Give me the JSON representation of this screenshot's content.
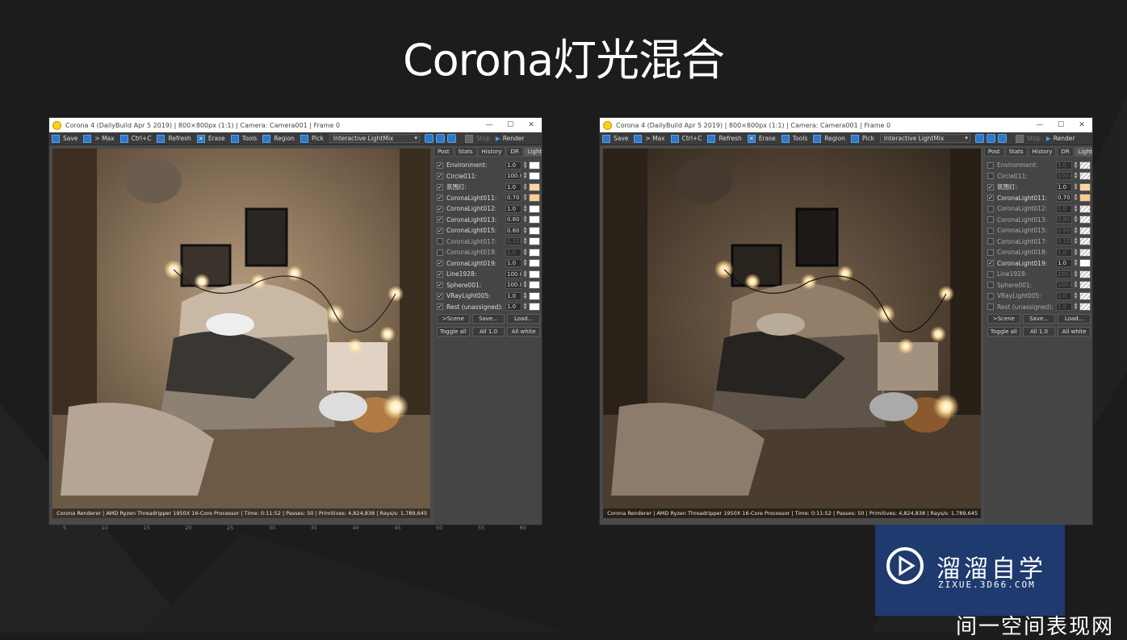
{
  "slide": {
    "title": "Corona灯光混合",
    "footer_text": "间一空间表现网"
  },
  "windows": [
    {
      "id": "left",
      "titlebar": "Corona 4 (DailyBuild Apr  5 2019) | 800×800px (1:1) | Camera: Camera001 | Frame 0",
      "toolbar": {
        "save": "Save",
        "max": "> Max",
        "copy": "Ctrl+C",
        "refresh": "Refresh",
        "erase": "Erase",
        "tools": "Tools",
        "region": "Region",
        "pick": "Pick",
        "dropdown": "Interactive LightMix",
        "stop": "Stop",
        "render": "Render"
      },
      "tabs": [
        "Post",
        "Stats",
        "History",
        "DR",
        "LightMix"
      ],
      "lights": [
        {
          "name": "Environment:",
          "value": "1.0",
          "checked": true,
          "swatch": "#ffffff"
        },
        {
          "name": "Circle011:",
          "value": "100.0",
          "checked": true,
          "swatch": "#ffffff"
        },
        {
          "name": "氛围灯:",
          "value": "1.0",
          "checked": true,
          "swatch": "#fdd5a3"
        },
        {
          "name": "CoronaLight011:",
          "value": "0.70",
          "checked": true,
          "swatch": "#fdcc8f"
        },
        {
          "name": "CoronaLight012:",
          "value": "1.0",
          "checked": true,
          "swatch": "#ffffff"
        },
        {
          "name": "CoronaLight013:",
          "value": "0.80",
          "checked": true,
          "swatch": "#ffffff"
        },
        {
          "name": "CoronaLight015:",
          "value": "0.80",
          "checked": true,
          "swatch": "#ffffff"
        },
        {
          "name": "CoronaLight017:",
          "value": "0.328",
          "checked": false,
          "swatch": "#ffffff"
        },
        {
          "name": "CoronaLight018:",
          "value": "1.0",
          "checked": false,
          "swatch": "#ffffff"
        },
        {
          "name": "CoronaLight019:",
          "value": "1.0",
          "checked": true,
          "swatch": "#ffffff"
        },
        {
          "name": "Line1928:",
          "value": "100.0",
          "checked": true,
          "swatch": "#ffffff"
        },
        {
          "name": "Sphere001:",
          "value": "100.0",
          "checked": true,
          "swatch": "#ffffff"
        },
        {
          "name": "VRayLight005:",
          "value": "1.0",
          "checked": true,
          "swatch": "#ffffff"
        },
        {
          "name": "Rest (unassigned):",
          "value": "1.0",
          "checked": true,
          "swatch": "#ffffff"
        }
      ],
      "buttons1": [
        ">Scene",
        "Save...",
        "Load..."
      ],
      "buttons2": [
        "Toggle all",
        "All 1.0",
        "All white"
      ],
      "status": "Corona Renderer | AMD Ryzen Threadripper 1950X 16-Core Processor  | Time: 0:11:52 | Passes: 50 | Primitives: 4,824,838 | Rays/s: 1,789,645"
    },
    {
      "id": "right",
      "titlebar": "Corona 4 (DailyBuild Apr  5 2019) | 800×800px (1:1) | Camera: Camera001 | Frame 0",
      "toolbar": {
        "save": "Save",
        "max": "> Max",
        "copy": "Ctrl+C",
        "refresh": "Refresh",
        "erase": "Erase",
        "tools": "Tools",
        "region": "Region",
        "pick": "Pick",
        "dropdown": "Interactive LightMix",
        "stop": "Stop",
        "render": "Render"
      },
      "tabs": [
        "Post",
        "Stats",
        "History",
        "DR",
        "LightMix"
      ],
      "lights": [
        {
          "name": "Environment:",
          "value": "1.0",
          "checked": false,
          "swatch": "hatch"
        },
        {
          "name": "Circle011:",
          "value": "100.0",
          "checked": false,
          "swatch": "hatch"
        },
        {
          "name": "氛围灯:",
          "value": "1.0",
          "checked": true,
          "swatch": "#fdd5a3"
        },
        {
          "name": "CoronaLight011:",
          "value": "0.70",
          "checked": true,
          "swatch": "#fdcc8f"
        },
        {
          "name": "CoronaLight012:",
          "value": "1.0",
          "checked": false,
          "swatch": "hatch"
        },
        {
          "name": "CoronaLight013:",
          "value": "0.80",
          "checked": false,
          "swatch": "hatch"
        },
        {
          "name": "CoronaLight015:",
          "value": "0.80",
          "checked": false,
          "swatch": "hatch"
        },
        {
          "name": "CoronaLight017:",
          "value": "0.328",
          "checked": false,
          "swatch": "hatch"
        },
        {
          "name": "CoronaLight018:",
          "value": "1.0",
          "checked": false,
          "swatch": "hatch"
        },
        {
          "name": "CoronaLight019:",
          "value": "1.0",
          "checked": true,
          "swatch": "#ffffff"
        },
        {
          "name": "Line1928:",
          "value": "100.0",
          "checked": false,
          "swatch": "hatch"
        },
        {
          "name": "Sphere001:",
          "value": "100.0",
          "checked": false,
          "swatch": "hatch"
        },
        {
          "name": "VRayLight005:",
          "value": "1.0",
          "checked": false,
          "swatch": "hatch"
        },
        {
          "name": "Rest (unassigned):",
          "value": "1.0",
          "checked": false,
          "swatch": "hatch"
        }
      ],
      "buttons1": [
        ">Scene",
        "Save...",
        "Load..."
      ],
      "buttons2": [
        "Toggle all",
        "All 1.0",
        "All white"
      ],
      "status": "Corona Renderer | AMD Ryzen Threadripper 1950X 16-Core Processor  | Time: 0:11:52 | Passes: 50 | Primitives: 4,824,838 | Rays/s: 1,789,645"
    }
  ],
  "ruler": [
    "5",
    "10",
    "15",
    "20",
    "25",
    "30",
    "35",
    "40",
    "45",
    "50",
    "55",
    "60"
  ],
  "logo": {
    "cn": "溜溜自学",
    "en": "ZIXUE.3D66.COM"
  }
}
